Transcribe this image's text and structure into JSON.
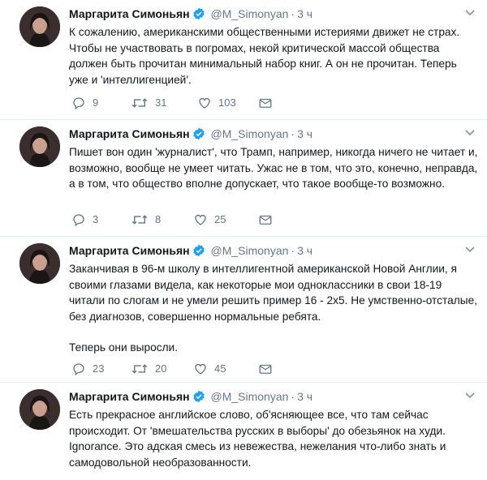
{
  "tweets": [
    {
      "name": "Маргарита Симоньян",
      "handle": "@M_Simonyan",
      "separator": "·",
      "time": "3 ч",
      "text": [
        "К сожалению, американскими общественными истериями движет не страх. Чтобы не участвовать в погромах, некой критической массой общества должен быть прочитан минимальный набор книг. А он не прочитан. Теперь уже и 'интеллигенцией'."
      ],
      "replies": "9",
      "retweets": "31",
      "likes": "103"
    },
    {
      "name": "Маргарита Симоньян",
      "handle": "@M_Simonyan",
      "separator": "·",
      "time": "3 ч",
      "text": [
        "Пишет вон один 'журналист', что Трамп, например, никогда ничего не читает и, возможно, вообще не умеет читать. Ужас не в том, что это, конечно, неправда, а в том, что общество вполне допускает, что такое вообще-то возможно."
      ],
      "replies": "3",
      "retweets": "8",
      "likes": "25"
    },
    {
      "name": "Маргарита Симоньян",
      "handle": "@M_Simonyan",
      "separator": "·",
      "time": "3 ч",
      "text": [
        "Заканчивая в 96-м школу в интеллигентной американской Новой Англии, я своими глазами видела, как некоторые мои одноклассники в свои 18-19 читали по слогам и не умели решить пример 16 - 2x5. Не умственно-отсталые, без диагнозов, совершенно нормальные ребята.",
        "Теперь они выросли."
      ],
      "replies": "23",
      "retweets": "20",
      "likes": "45"
    },
    {
      "name": "Маргарита Симоньян",
      "handle": "@M_Simonyan",
      "separator": "·",
      "time": "3 ч",
      "text": [
        "Есть прекрасное английское слово, об'ясняющее все, что там сейчас происходит. От 'вмешательства русских в выборы' до обезьянок на худи. Ignorance. Это адская смесь из невежества, нежелания что-либо знать и самодовольной необразованности."
      ]
    }
  ],
  "colors": {
    "verified": "#1da1f2",
    "meta": "#657786",
    "divider": "#e6ecf0"
  },
  "icons": [
    "avatar",
    "verified-badge-icon",
    "chevron-down-icon",
    "reply-icon",
    "retweet-icon",
    "like-icon",
    "message-icon"
  ]
}
